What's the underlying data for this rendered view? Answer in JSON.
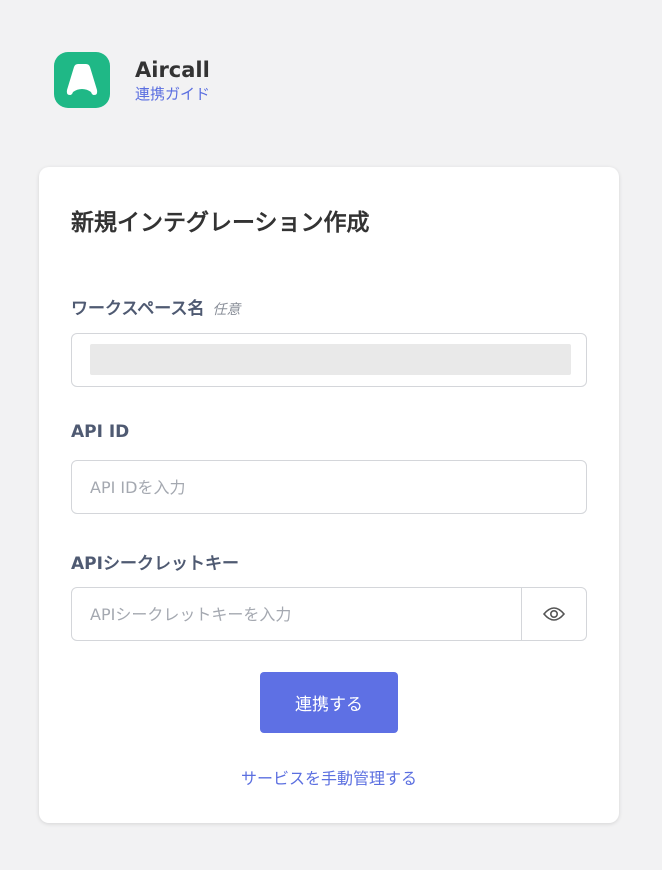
{
  "header": {
    "app_name": "Aircall",
    "guide_link": "連携ガイド",
    "logo_icon": "aircall-logo-icon",
    "brand_color": "#1fb886"
  },
  "card": {
    "title": "新規インテグレーション作成",
    "workspace": {
      "label": "ワークスペース名",
      "optional_tag": "任意",
      "value": ""
    },
    "api_id": {
      "label": "API ID",
      "placeholder": "API IDを入力",
      "value": ""
    },
    "api_secret": {
      "label": "APIシークレットキー",
      "placeholder": "APIシークレットキーを入力",
      "value": "",
      "toggle_icon": "eye-icon"
    },
    "submit_label": "連携する",
    "manual_link": "サービスを手動管理する"
  },
  "colors": {
    "accent": "#5e70e4",
    "link": "#5b6fe0",
    "label": "#4f5a72"
  }
}
